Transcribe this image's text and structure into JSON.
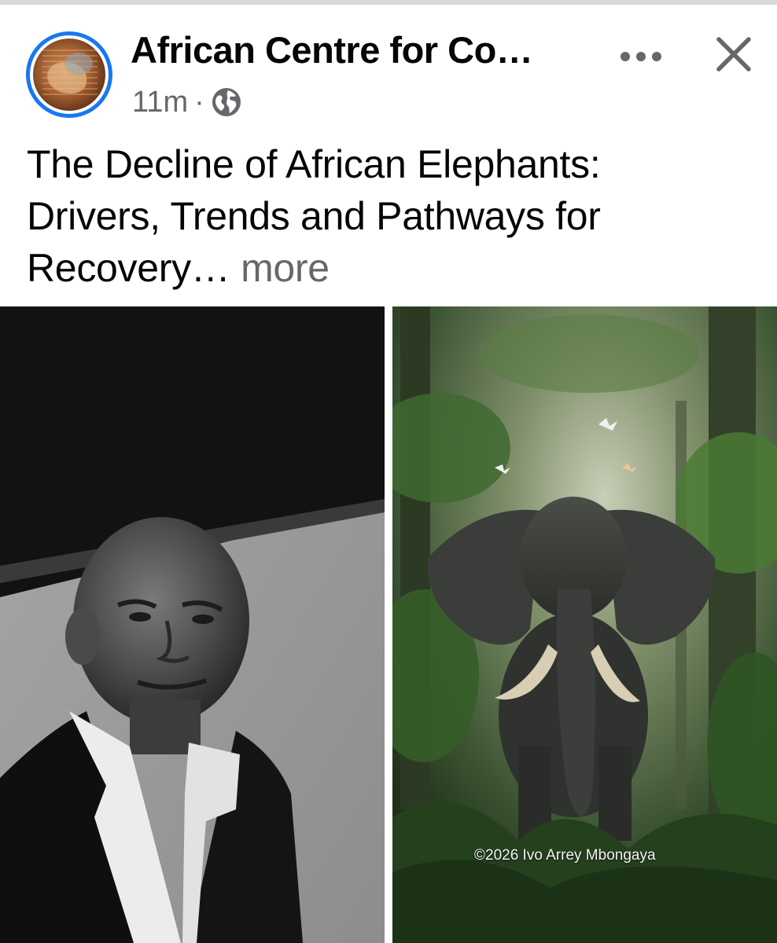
{
  "post": {
    "page_name": "African Centre for Co…",
    "timestamp": "11m",
    "separator": "·",
    "audience_icon": "globe-icon",
    "text_lines": [
      "The Decline of African Elephants:",
      "Drivers, Trends and Pathways for",
      "Recovery…"
    ],
    "see_more": "more",
    "more_options_icon": "more-horizontal-icon",
    "close_icon": "close-icon"
  },
  "media": {
    "left_photo": "portrait-photo",
    "right_photo": "elephant-photo",
    "credit": "©2026 Ivo Arrey Mbongaya"
  },
  "colors": {
    "name_text": "#050505",
    "meta_text": "#65676b",
    "avatar_ring": "#1877f2"
  }
}
